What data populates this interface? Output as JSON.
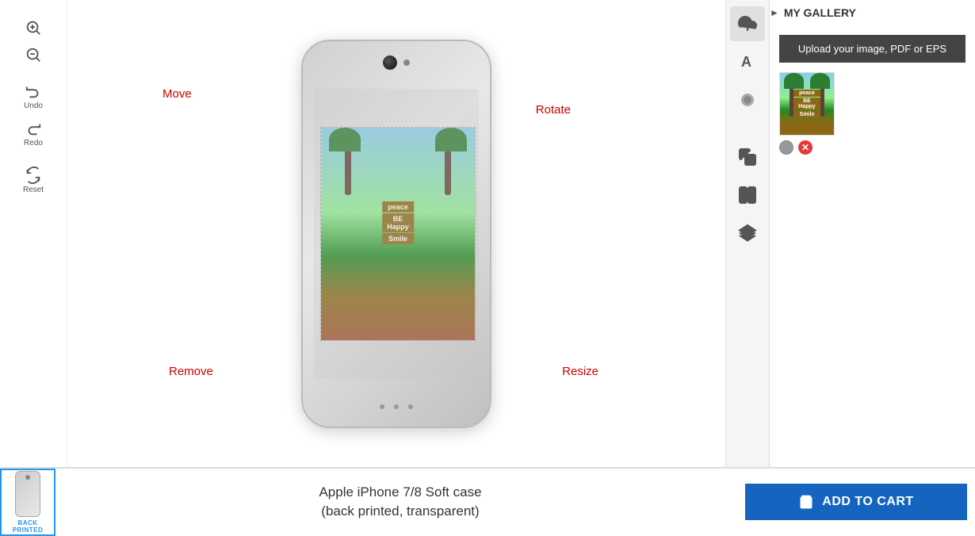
{
  "toolbar": {
    "zoom_in_label": "Zoom In",
    "zoom_out_label": "Zoom Out",
    "undo_label": "Undo",
    "redo_label": "Redo",
    "reset_label": "Reset"
  },
  "canvas": {
    "labels": {
      "move": "Move",
      "rotate": "Rotate",
      "remove": "Remove",
      "resize": "Resize"
    }
  },
  "right_toolbar": {
    "upload_icon": "upload",
    "text_icon": "text",
    "effects_icon": "effects",
    "copy_icon": "copy",
    "preview_icon": "preview",
    "layers_icon": "layers"
  },
  "panel": {
    "gallery_label": "MY GALLERY",
    "upload_btn": "Upload your image, PDF or EPS"
  },
  "product": {
    "name": "Apple iPhone 7/8 Soft case",
    "description": "(back printed, transparent)",
    "back_printed_label": "BACK PRINTED",
    "add_to_cart_label": "ADD TO CART"
  }
}
